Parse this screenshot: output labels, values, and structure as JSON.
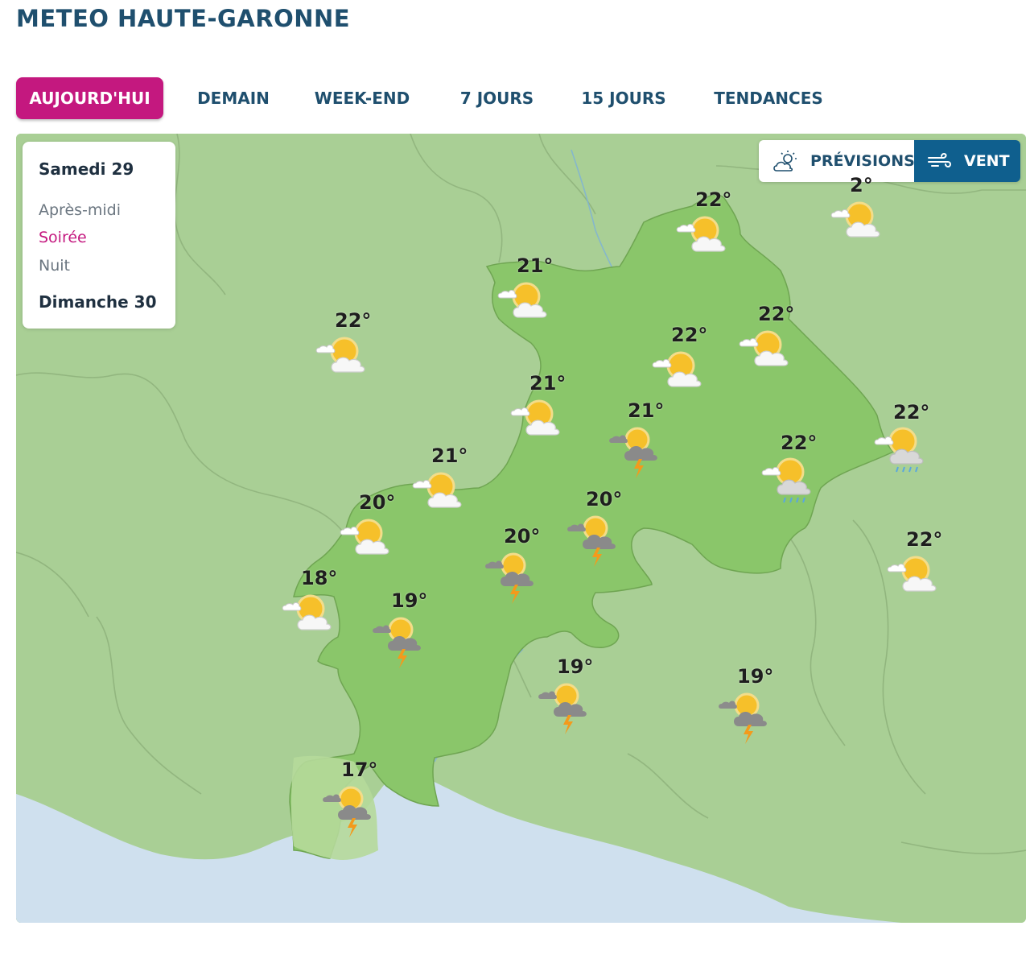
{
  "page": {
    "title": "METEO HAUTE-GARONNE"
  },
  "tabs": [
    {
      "label": "AUJOURD'HUI",
      "active": true
    },
    {
      "label": "DEMAIN",
      "active": false
    },
    {
      "label": "WEEK-END",
      "active": false
    },
    {
      "label": "7 JOURS",
      "active": false
    },
    {
      "label": "15 JOURS",
      "active": false
    },
    {
      "label": "TENDANCES",
      "active": false
    }
  ],
  "periods": {
    "day1": "Samedi 29",
    "items": [
      {
        "label": "Après-midi",
        "active": false
      },
      {
        "label": "Soirée",
        "active": true
      },
      {
        "label": "Nuit",
        "active": false
      }
    ],
    "day2": "Dimanche 30"
  },
  "map_toggle": {
    "forecast_label": "PRÉVISIONS",
    "forecast_icon": "sun-cloud-outline-icon",
    "wind_label": "VENT",
    "wind_icon": "wind-icon",
    "active": "wind"
  },
  "colors": {
    "accent": "#c4187f",
    "toggle_active": "#0f5f8e",
    "text_dark": "#1f4f6e",
    "map_land": "#a9cf95",
    "map_region": "#8ac66a",
    "map_sea": "#cfe0ee"
  },
  "forecasts": [
    {
      "temp": "22°",
      "icon": "sun-cloud-icon"
    },
    {
      "temp": "2°",
      "icon": "sun-cloud-icon"
    },
    {
      "temp": "21°",
      "icon": "sun-cloud-icon"
    },
    {
      "temp": "22°",
      "icon": "sun-cloud-icon"
    },
    {
      "temp": "22°",
      "icon": "sun-cloud-icon"
    },
    {
      "temp": "22°",
      "icon": "sun-cloud-icon"
    },
    {
      "temp": "21°",
      "icon": "sun-cloud-icon"
    },
    {
      "temp": "21°",
      "icon": "storm-icon"
    },
    {
      "temp": "22°",
      "icon": "sun-rain-icon"
    },
    {
      "temp": "22°",
      "icon": "sun-rain-icon"
    },
    {
      "temp": "21°",
      "icon": "sun-cloud-icon"
    },
    {
      "temp": "20°",
      "icon": "sun-cloud-icon"
    },
    {
      "temp": "20°",
      "icon": "storm-icon"
    },
    {
      "temp": "20°",
      "icon": "storm-icon"
    },
    {
      "temp": "22°",
      "icon": "sun-cloud-icon"
    },
    {
      "temp": "18°",
      "icon": "sun-cloud-icon"
    },
    {
      "temp": "19°",
      "icon": "storm-icon"
    },
    {
      "temp": "19°",
      "icon": "storm-icon"
    },
    {
      "temp": "19°",
      "icon": "storm-icon"
    },
    {
      "temp": "17°",
      "icon": "storm-icon"
    }
  ]
}
